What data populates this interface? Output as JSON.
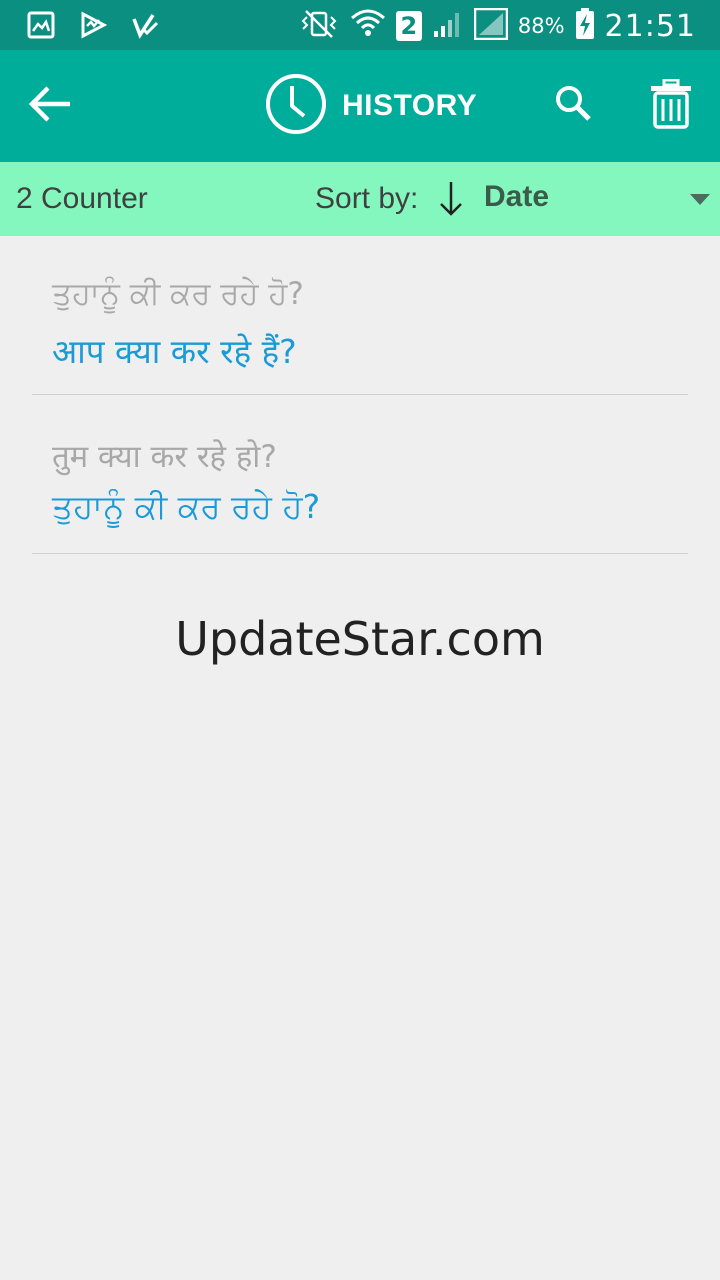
{
  "status_bar": {
    "sim_slot": "2",
    "battery": "88%",
    "time": "21:51",
    "icons": [
      "gallery-icon",
      "play-store-icon",
      "check-icon",
      "vibrate-icon",
      "wifi-icon",
      "signal-icon",
      "signal-icon",
      "battery-charging-icon"
    ]
  },
  "app_bar": {
    "title": "HISTORY",
    "icons": [
      "back-arrow-icon",
      "clock-icon",
      "search-icon",
      "trash-icon"
    ],
    "color": "#00ad9a"
  },
  "sort_bar": {
    "counter": "2 Counter",
    "sort_by_label": "Sort by:",
    "sort_value": "Date",
    "color": "#84f7bf"
  },
  "history": [
    {
      "source": "ਤੁਹਾਨੂੰ ਕੀ ਕਰ ਰਹੇ ਹੋ?",
      "translation": "आप क्या कर रहे हैं?"
    },
    {
      "source": "तुम क्या कर रहे हो?",
      "translation": "ਤੁਹਾਨੂੰ ਕੀ ਕਰ ਰਹੇ ਹੋ?"
    }
  ],
  "watermark": "UpdateStar.com",
  "colors": {
    "status_bar": "#0a8f80",
    "translation_text": "#1a9bd7",
    "source_text": "#a8a8a8"
  }
}
